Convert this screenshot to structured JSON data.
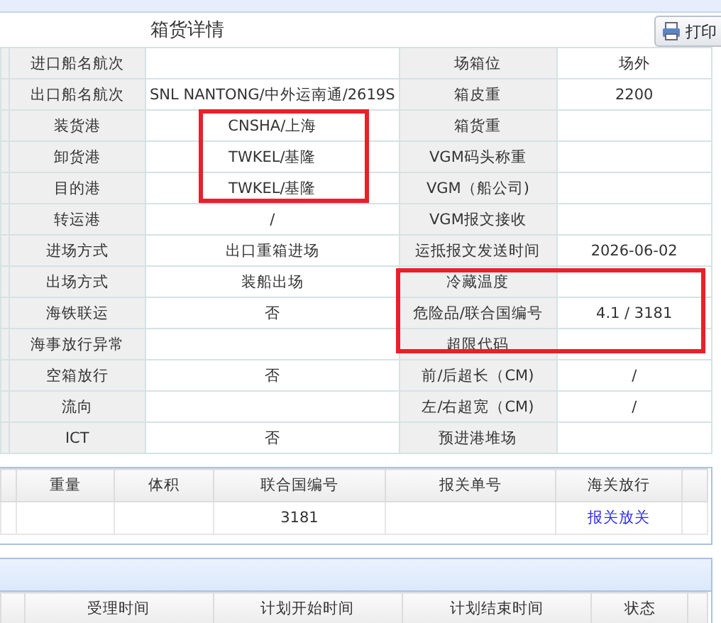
{
  "panel": {
    "title": "箱货详情",
    "print_button": "打印"
  },
  "detail_rows": [
    {
      "label_1": "进口船名航次",
      "value_1": "",
      "label_2": "场箱位",
      "value_2": "场外"
    },
    {
      "label_1": "出口船名航次",
      "value_1": "SNL NANTONG/中外运南通/2619S",
      "label_2": "箱皮重",
      "value_2": "2200"
    },
    {
      "label_1": "装货港",
      "value_1": "CNSHA/上海",
      "label_2": "箱货重",
      "value_2": ""
    },
    {
      "label_1": "卸货港",
      "value_1": "TWKEL/基隆",
      "label_2": "VGM码头称重",
      "value_2": ""
    },
    {
      "label_1": "目的港",
      "value_1": "TWKEL/基隆",
      "label_2": "VGM（船公司)",
      "value_2": ""
    },
    {
      "label_1": "转运港",
      "value_1": "/",
      "label_2": "VGM报文接收",
      "value_2": ""
    },
    {
      "label_1": "进场方式",
      "value_1": "出口重箱进场",
      "label_2": "运抵报文发送时间",
      "value_2": "2026-06-02"
    },
    {
      "label_1": "出场方式",
      "value_1": "装船出场",
      "label_2": "冷藏温度",
      "value_2": ""
    },
    {
      "label_1": "海铁联运",
      "value_1": "否",
      "label_2": "危险品/联合国编号",
      "value_2": "4.1 / 3181"
    },
    {
      "label_1": "海事放行异常",
      "value_1": "",
      "label_2": "超限代码",
      "value_2": ""
    },
    {
      "label_1": "空箱放行",
      "value_1": "否",
      "label_2": "前/后超长（CM)",
      "value_2": "/"
    },
    {
      "label_1": "流向",
      "value_1": "",
      "label_2": "左/右超宽（CM)",
      "value_2": "/"
    },
    {
      "label_1": "ICT",
      "value_1": "否",
      "label_2": "预进港堆场",
      "value_2": ""
    }
  ],
  "cargo_table": {
    "columns": [
      "重量",
      "体积",
      "联合国编号",
      "报关单号",
      "海关放行"
    ],
    "rows": [
      {
        "weight": "",
        "volume": "",
        "un_number": "3181",
        "declaration_no": "",
        "customs": "报关放关"
      }
    ]
  },
  "plan_table": {
    "columns": [
      "受理时间",
      "计划开始时间",
      "计划结束时间",
      "状态"
    ]
  }
}
